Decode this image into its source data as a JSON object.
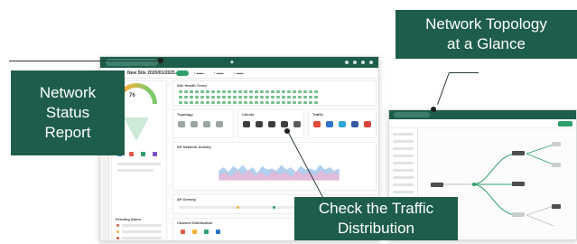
{
  "callouts": {
    "status_line1": "Network",
    "status_line2": "Status",
    "status_line3": "Report",
    "topology_line1": "Network Topology",
    "topology_line2": "at a Glance",
    "traffic_line1": "Check the Traffic",
    "traffic_line2": "Distribution"
  },
  "dashboard": {
    "site_name": "New Site 2020/01/2025...",
    "gauge_value": "76",
    "sections": {
      "trend": "Site Health Trend",
      "topology": "Topology",
      "clients": "Clients",
      "traffic": "Traffic",
      "activity": "AP Network Activity",
      "ap_density": "AP Density",
      "channel": "Channel Distribution",
      "alarms": "Pending Alarm"
    }
  },
  "colors": {
    "brand": "#1e5d4b",
    "accent": "#2f9e6b",
    "health_good": "#74c08a"
  }
}
